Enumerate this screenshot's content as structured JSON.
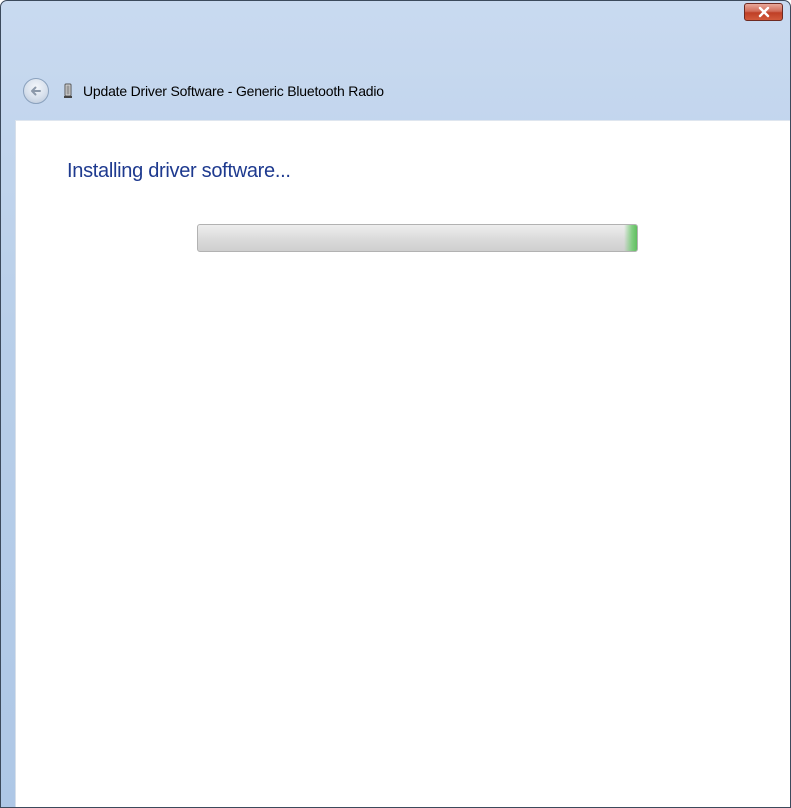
{
  "window": {
    "title": "Update Driver Software - Generic Bluetooth Radio",
    "close_button": "close-icon",
    "back_button": "back-arrow-icon",
    "device_icon": "bluetooth-radio-icon"
  },
  "main": {
    "heading": "Installing driver software...",
    "progress": {
      "indeterminate": true,
      "fill_fraction": 0.03
    }
  },
  "colors": {
    "heading": "#1e3a8f",
    "close_button": "#c9483a",
    "progress_fill": "#5fbf5f",
    "frame": "#b9cfe9"
  }
}
